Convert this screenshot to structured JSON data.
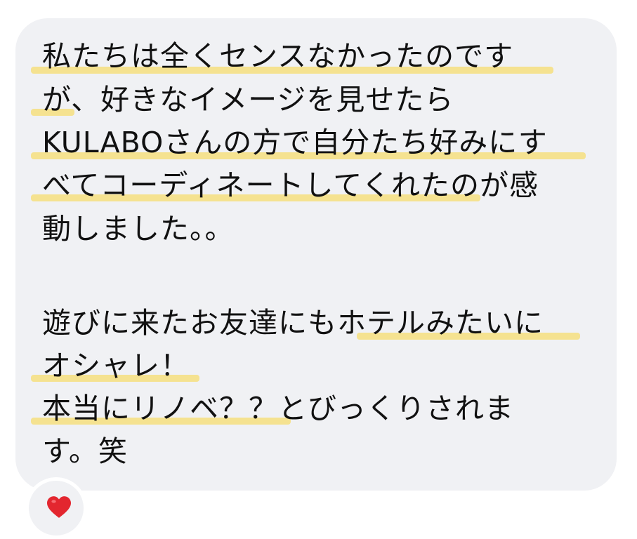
{
  "message": {
    "lines": [
      "私たちは全くセンスなかったのです",
      "が、好きなイメージを見せたら",
      "KULABOさんの方で自分たち好みにす",
      "べてコーディネートしてくれたのが感",
      "動しました。。",
      "遊びに来たお友達にもホテルみたいに",
      "オシャレ！",
      "本当にリノベ？？とびっくりされま",
      "す。笑"
    ]
  },
  "reaction": {
    "icon": "heart-icon",
    "color": "#e3262f"
  },
  "colors": {
    "bubble": "#f0f1f4",
    "highlight": "#f4e08a",
    "text": "#111111"
  }
}
